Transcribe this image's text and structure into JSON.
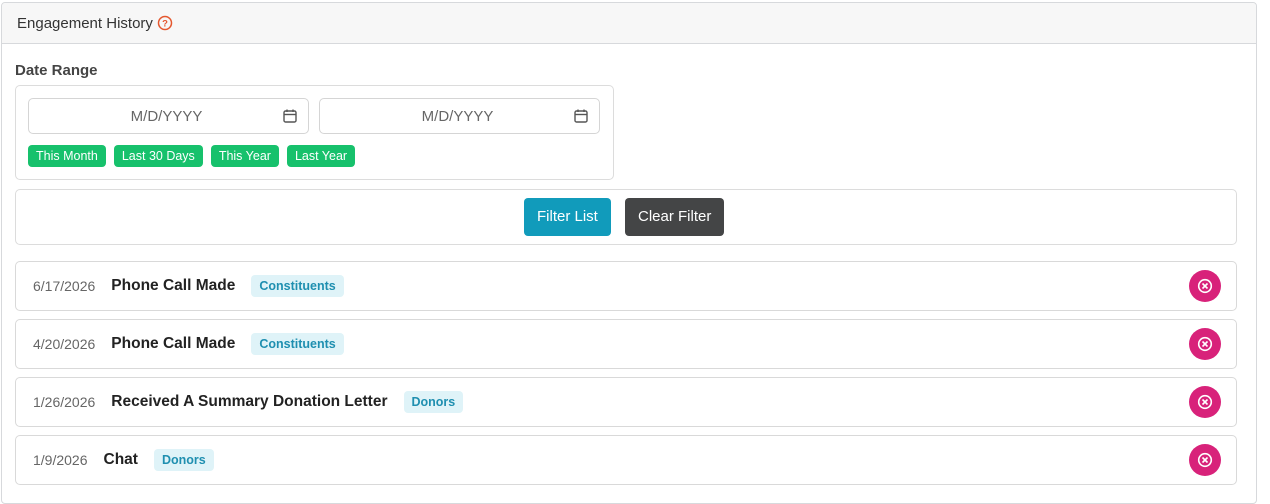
{
  "header": {
    "title": "Engagement History"
  },
  "date_range": {
    "label": "Date Range",
    "start_placeholder": "M/D/YYYY",
    "end_placeholder": "M/D/YYYY",
    "quick": [
      "This Month",
      "Last 30 Days",
      "This Year",
      "Last Year"
    ]
  },
  "actions": {
    "filter_label": "Filter List",
    "clear_label": "Clear Filter"
  },
  "rows": [
    {
      "date": "6/17/2026",
      "title": "Phone Call Made",
      "tag": "Constituents"
    },
    {
      "date": "4/20/2026",
      "title": "Phone Call Made",
      "tag": "Constituents"
    },
    {
      "date": "1/26/2026",
      "title": "Received A Summary Donation Letter",
      "tag": "Donors"
    },
    {
      "date": "1/9/2026",
      "title": "Chat",
      "tag": "Donors"
    }
  ],
  "colors": {
    "quick_button": "#17c16c",
    "filter_button": "#119bbb",
    "clear_button": "#444546",
    "delete_button": "#d8227a",
    "help_icon": "#e4572e"
  }
}
